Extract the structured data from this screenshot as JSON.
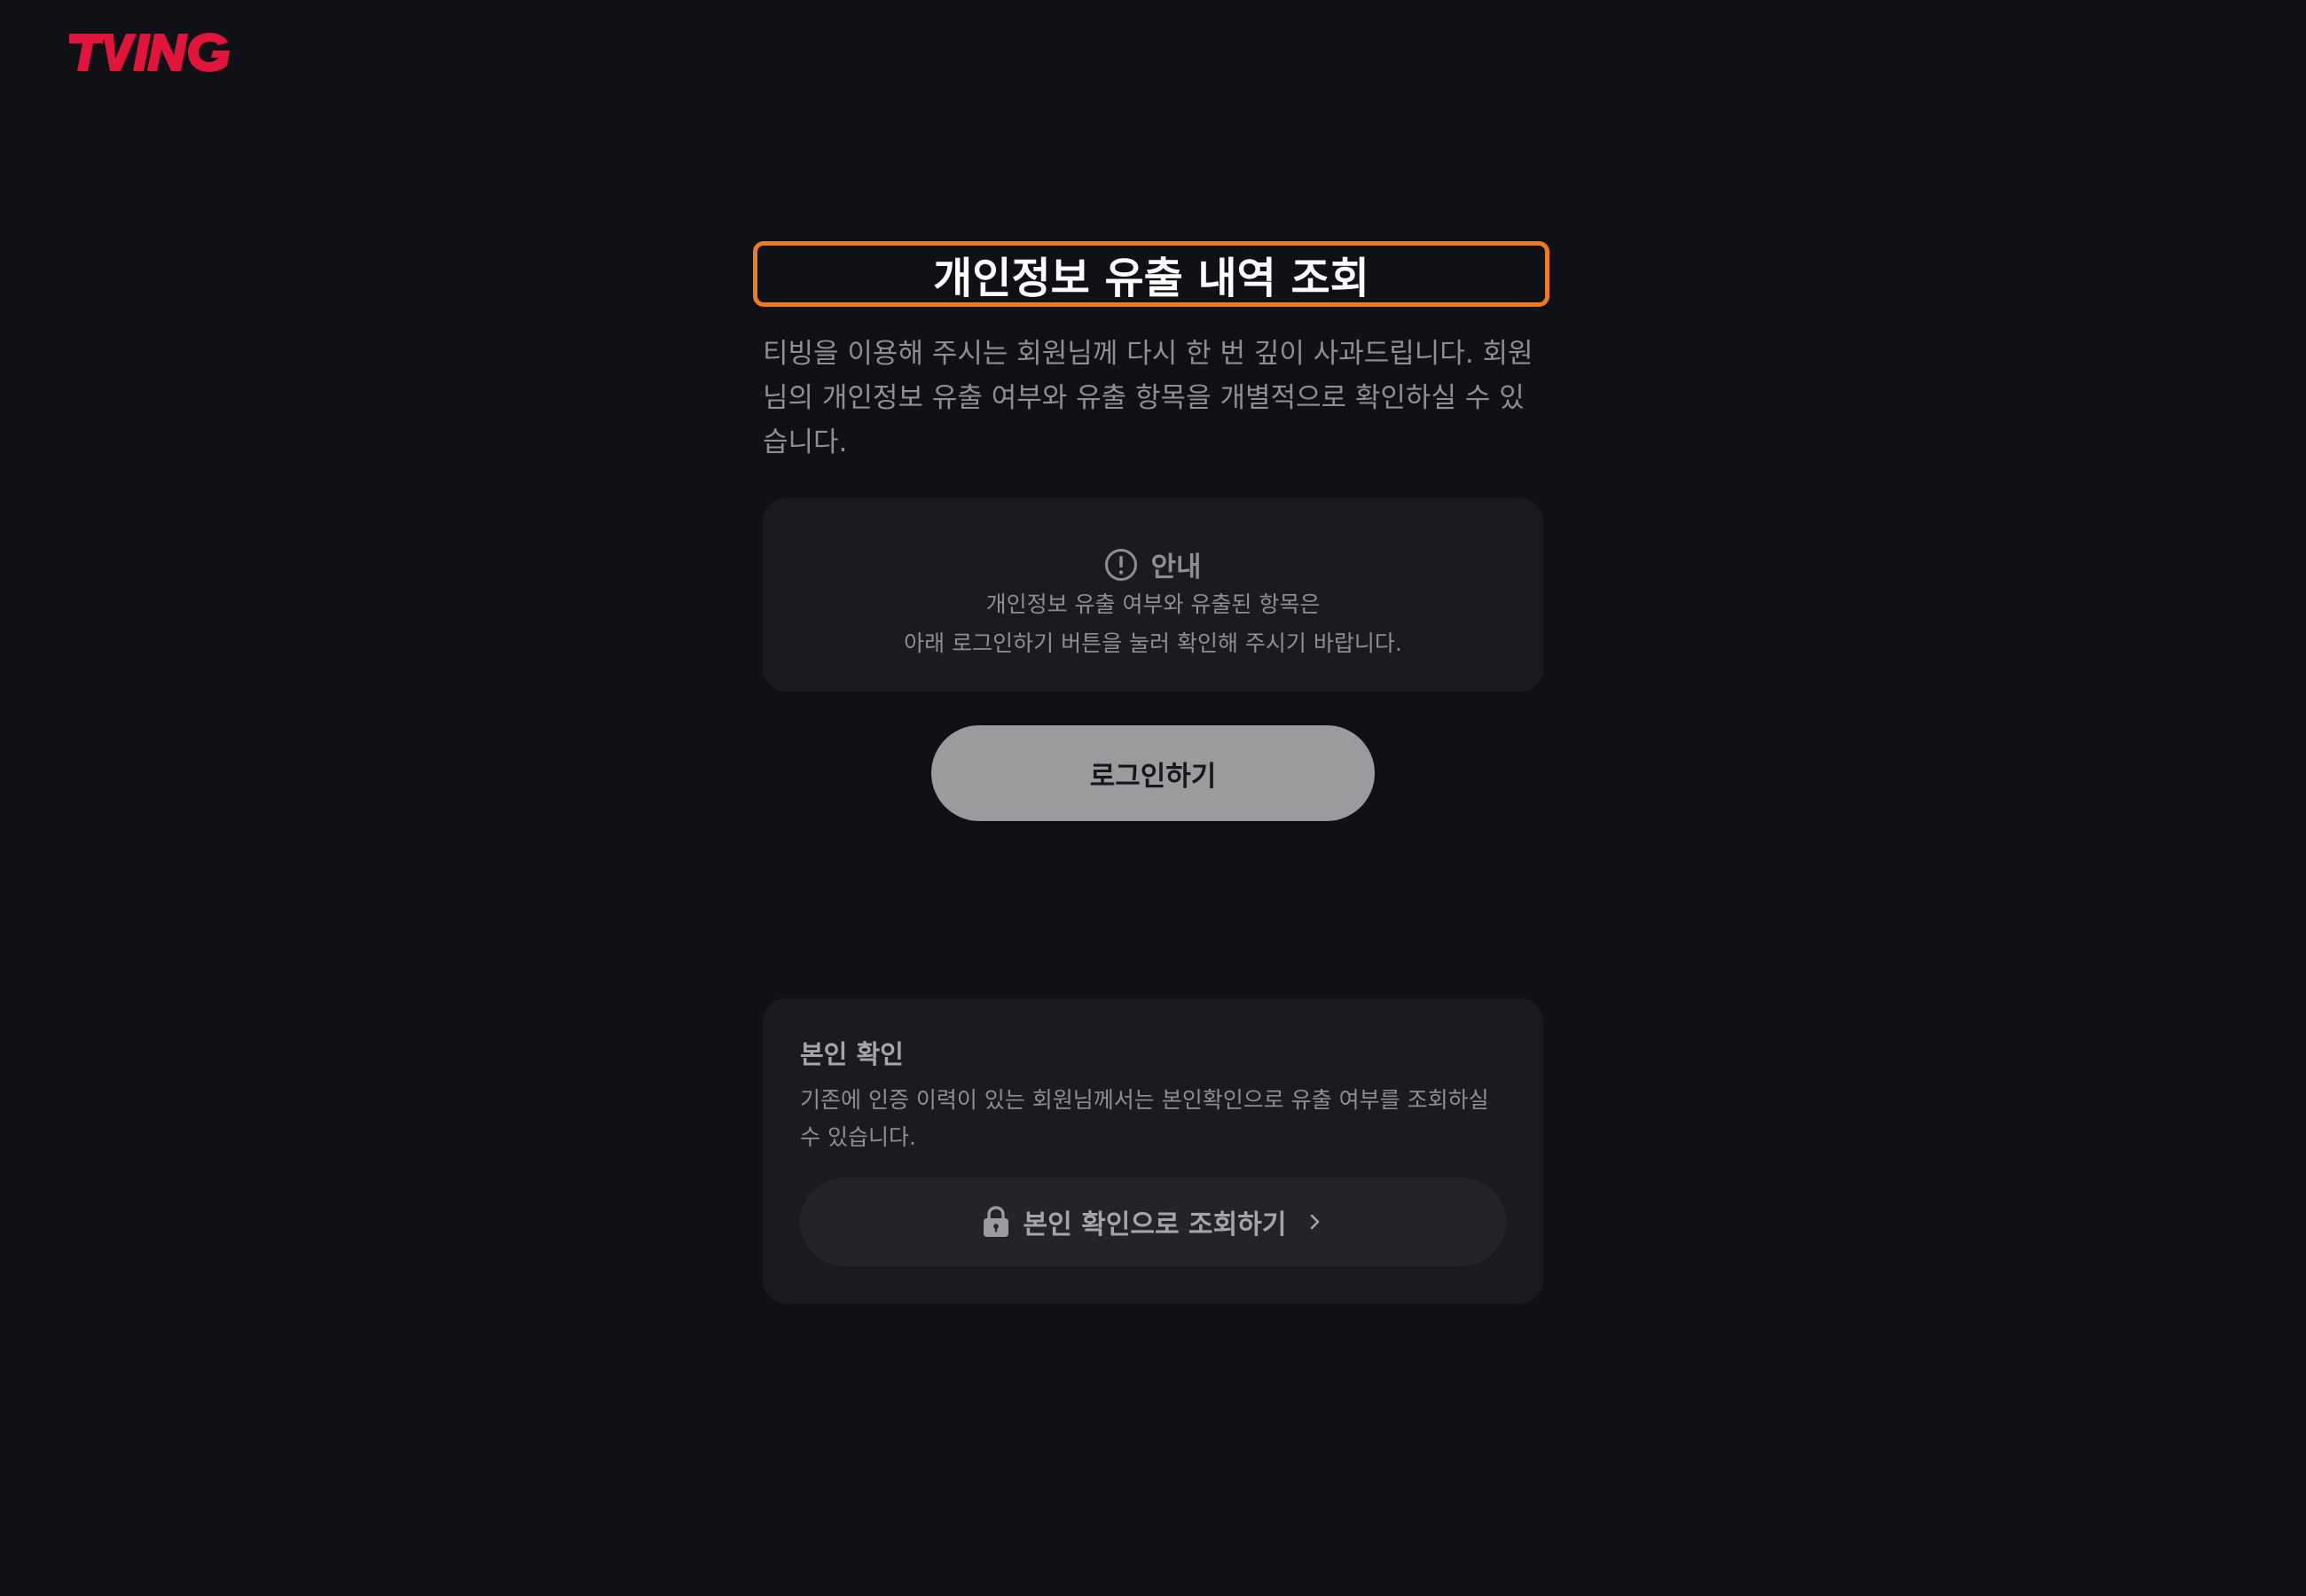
{
  "brand": {
    "logo_text": "TVING",
    "color": "#e1143c"
  },
  "main": {
    "title": "개인정보 유출 내역 조회",
    "description": "티빙을 이용해 주시는 회원님께 다시 한 번 깊이 사과드립니다. 회원님의 개인정보 유출 여부와 유출 항목을 개별적으로 확인하실 수 있습니다.",
    "notice": {
      "icon": "exclamation-circle-icon",
      "title": "안내",
      "line1": "개인정보 유출 여부와 유출된 항목은",
      "line2": "아래 로그인하기 버튼을 눌러 확인해 주시기 바랍니다."
    },
    "login_label": "로그인하기"
  },
  "verify": {
    "title": "본인 확인",
    "description": "기존에 인증 이력이 있는 회원님께서는 본인확인으로 유출 여부를 조회하실 수 있습니다.",
    "button_label": "본인 확인으로 조회하기",
    "button_icon": "lock-icon",
    "chevron_icon": "chevron-right-icon"
  },
  "colors": {
    "background": "#101116",
    "highlight_border": "#f07a1f",
    "card": "#1a1b20",
    "button": "#9b9b9d"
  }
}
